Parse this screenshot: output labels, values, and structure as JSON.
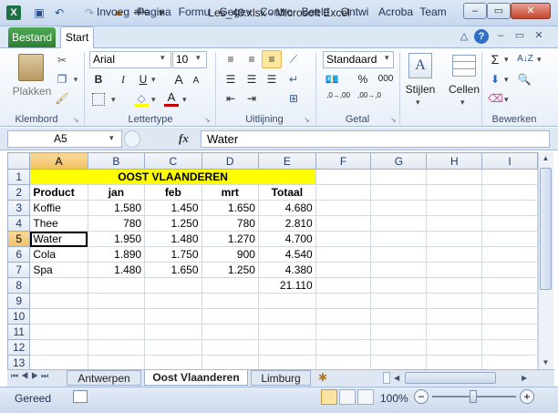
{
  "window": {
    "title": "Les_40.xlsx - Microsoft Excel",
    "minimize": "–",
    "maximize": "▭",
    "close": "✕"
  },
  "qat": {
    "undo": "↶",
    "redo": "↷",
    "spell": "abc"
  },
  "tabs": {
    "file": "Bestand",
    "items": [
      "Start",
      "Invoeg",
      "Pagina",
      "Formu",
      "Gegev",
      "Contro",
      "Beeld",
      "Ontwi",
      "Acroba",
      "Team"
    ]
  },
  "ribbon": {
    "clipboard": {
      "paste": "Plakken",
      "label": "Klembord"
    },
    "font": {
      "name": "Arial",
      "size": "10",
      "bold": "B",
      "italic": "I",
      "underline": "U",
      "grow": "A",
      "shrink": "A",
      "color_letter": "A",
      "label": "Lettertype"
    },
    "alignment": {
      "label": "Uitlijning"
    },
    "number": {
      "format": "Standaard",
      "percent": "%",
      "thousands": "000",
      "inc": ",0→,00",
      "dec": ",00→,0",
      "label": "Getal"
    },
    "styles": {
      "label": "Stijlen"
    },
    "cells": {
      "label": "Cellen"
    },
    "editing": {
      "sum": "Σ",
      "sort": "A↓Z",
      "label": "Bewerken"
    }
  },
  "formula_bar": {
    "name_box": "A5",
    "fx": "fx",
    "value": "Water"
  },
  "sheet": {
    "columns": [
      "A",
      "B",
      "C",
      "D",
      "E",
      "F",
      "G",
      "H",
      "I"
    ],
    "rows": [
      {
        "n": "1",
        "cells": [
          "OOST VLAANDEREN"
        ]
      },
      {
        "n": "2",
        "cells": [
          "Product",
          "jan",
          "feb",
          "mrt",
          "Totaal",
          "",
          "",
          "",
          ""
        ]
      },
      {
        "n": "3",
        "cells": [
          "Koffie",
          "1.580",
          "1.450",
          "1.650",
          "4.680",
          "",
          "",
          "",
          ""
        ]
      },
      {
        "n": "4",
        "cells": [
          "Thee",
          "780",
          "1.250",
          "780",
          "2.810",
          "",
          "",
          "",
          ""
        ]
      },
      {
        "n": "5",
        "cells": [
          "Water",
          "1.950",
          "1.480",
          "1.270",
          "4.700",
          "",
          "",
          "",
          ""
        ]
      },
      {
        "n": "6",
        "cells": [
          "Cola",
          "1.890",
          "1.750",
          "900",
          "4.540",
          "",
          "",
          "",
          ""
        ]
      },
      {
        "n": "7",
        "cells": [
          "Spa",
          "1.480",
          "1.650",
          "1.250",
          "4.380",
          "",
          "",
          "",
          ""
        ]
      },
      {
        "n": "8",
        "cells": [
          "",
          "",
          "",
          "",
          "21.110",
          "",
          "",
          "",
          ""
        ]
      },
      {
        "n": "9",
        "cells": [
          "",
          "",
          "",
          "",
          "",
          "",
          "",
          "",
          ""
        ]
      },
      {
        "n": "10",
        "cells": [
          "",
          "",
          "",
          "",
          "",
          "",
          "",
          "",
          ""
        ]
      },
      {
        "n": "11",
        "cells": [
          "",
          "",
          "",
          "",
          "",
          "",
          "",
          "",
          ""
        ]
      },
      {
        "n": "12",
        "cells": [
          "",
          "",
          "",
          "",
          "",
          "",
          "",
          "",
          ""
        ]
      },
      {
        "n": "13",
        "cells": [
          "",
          "",
          "",
          "",
          "",
          "",
          "",
          "",
          ""
        ]
      }
    ],
    "banner_color": "#ffff00"
  },
  "sheet_tabs": [
    "Antwerpen",
    "Oost Vlaanderen",
    "Limburg"
  ],
  "status": {
    "ready": "Gereed",
    "zoom": "100%",
    "minus": "−",
    "plus": "+"
  }
}
